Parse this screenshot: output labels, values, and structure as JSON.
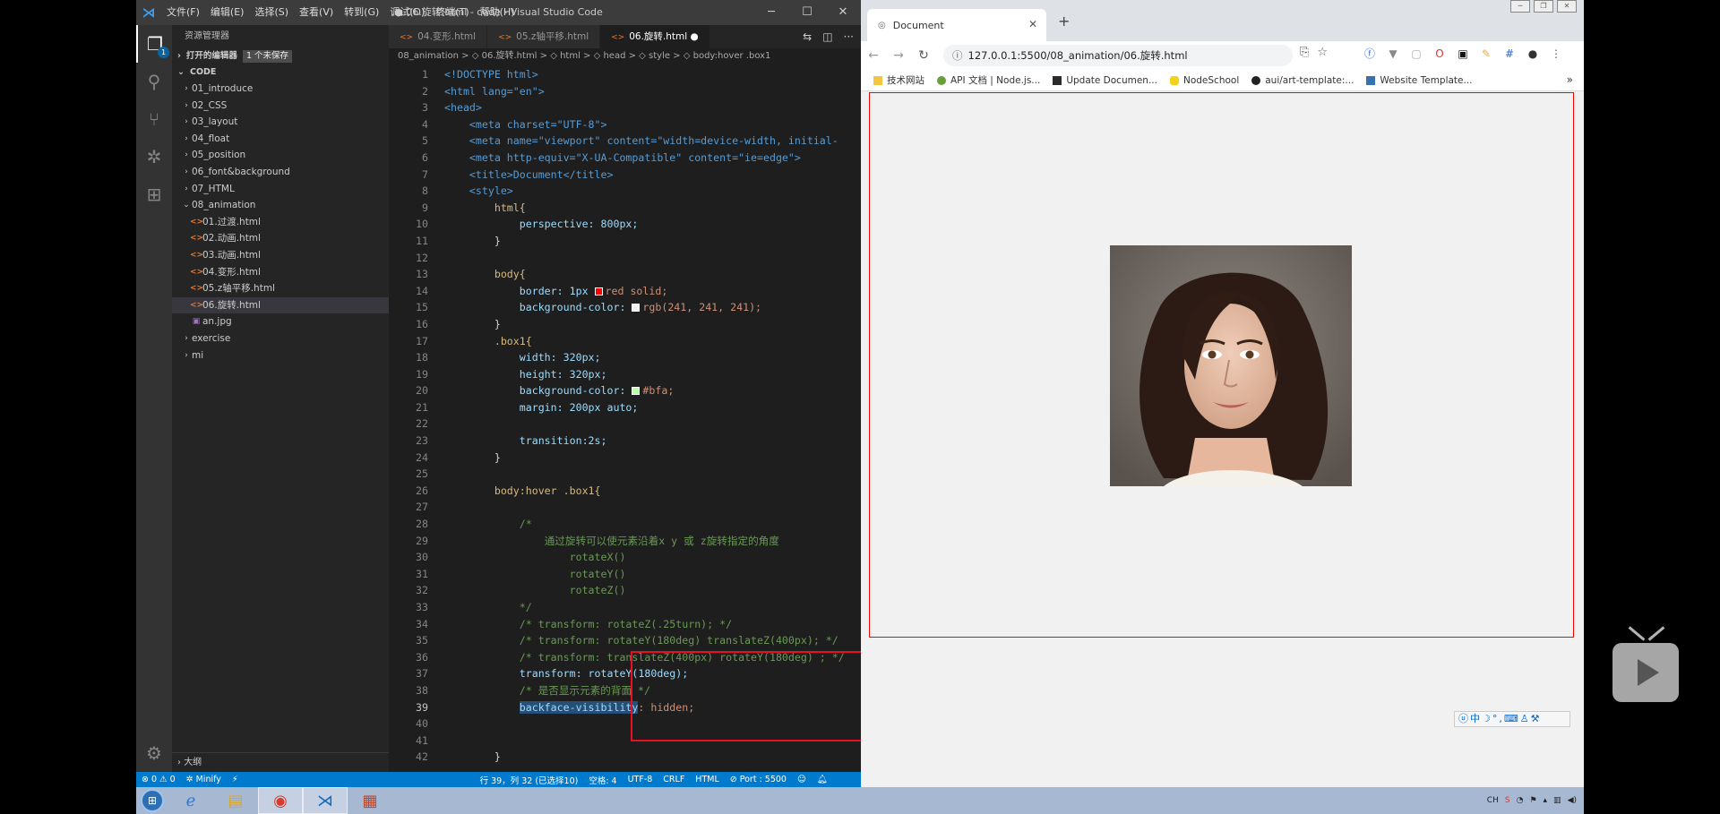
{
  "vscode": {
    "menu": [
      "文件(F)",
      "编辑(E)",
      "选择(S)",
      "查看(V)",
      "转到(G)",
      "调试(D)",
      "终端(T)",
      "帮助(H)"
    ],
    "window_title": "● 06.旋转.html - code - Visual Studio Code",
    "activity_badge": "1",
    "sidebar": {
      "header": "资源管理器",
      "open_editors": "打开的编辑器",
      "unsaved": "1 个未保存",
      "root": "CODE",
      "tree": [
        {
          "label": "01_introduce"
        },
        {
          "label": "02_CSS"
        },
        {
          "label": "03_layout"
        },
        {
          "label": "04_float"
        },
        {
          "label": "05_position"
        },
        {
          "label": "06_font&background"
        },
        {
          "label": "07_HTML"
        },
        {
          "label": "08_animation"
        },
        {
          "label": "01.过渡.html"
        },
        {
          "label": "02.动画.html"
        },
        {
          "label": "03.动画.html"
        },
        {
          "label": "04.变形.html"
        },
        {
          "label": "05.z轴平移.html"
        },
        {
          "label": "06.旋转.html"
        },
        {
          "label": "an.jpg"
        },
        {
          "label": "exercise"
        },
        {
          "label": "mi"
        }
      ],
      "outline": "大纲"
    },
    "tabs": [
      "04.变形.html",
      "05.z轴平移.html",
      "06.旋转.html"
    ],
    "breadcrumb": "08_animation > ◇ 06.旋转.html > ◇ html > ◇ head > ◇ style > ◇ body:hover .box1",
    "code_lines": [
      "1",
      "2",
      "3",
      "4",
      "5",
      "6",
      "7",
      "8",
      "9",
      "10",
      "11",
      "12",
      "13",
      "14",
      "15",
      "16",
      "17",
      "18",
      "19",
      "20",
      "21",
      "22",
      "23",
      "24",
      "25",
      "26",
      "27",
      "28",
      "29",
      "30",
      "31",
      "32",
      "33",
      "34",
      "35",
      "36",
      "37",
      "38",
      "39",
      "40",
      "41",
      "42"
    ],
    "code": {
      "doctype": "<!DOCTYPE html>",
      "html_open": "<html lang=\"en\">",
      "head_open": "<head>",
      "meta_charset": "<meta charset=\"UTF-8\">",
      "meta_viewport": "<meta name=\"viewport\" content=\"width=device-width, initial-",
      "meta_compat": "<meta http-equiv=\"X-UA-Compatible\" content=\"ie=edge\">",
      "title": "<title>Document</title>",
      "style_open": "<style>",
      "l9": "html{",
      "l10": "perspective: 800px;",
      "l11": "}",
      "l13": "body{",
      "l14a": "border: 1px ",
      "l14b": "red solid;",
      "l15a": "background-color: ",
      "l15b": "rgb(241, 241, 241);",
      "l16": "}",
      "l17": ".box1{",
      "l18": "width: 320px;",
      "l19": "height: 320px;",
      "l20a": "background-color: ",
      "l20b": "#bfa;",
      "l21": "margin: 200px auto;",
      "l23": "transition:2s;",
      "l24": "}",
      "l26": "body:hover .box1{",
      "l28": "/*",
      "l29": "通过旋转可以使元素沿着x y 或 z旋转指定的角度",
      "l30": "rotateX()",
      "l31": "rotateY()",
      "l32": "rotateZ()",
      "l33": "*/",
      "l34": "/* transform: rotateZ(.25turn); */",
      "l35": "/* transform: rotateY(180deg) translateZ(400px); */",
      "l36": "/* transform: translateZ(400px) rotateY(180deg) ; */",
      "l37": "transform: rotateY(180deg);",
      "l38": "/* 是否显示元素的背面 */",
      "l39a": "backface-visibility",
      "l39b": ": hidden;",
      "l42": "}"
    },
    "status": {
      "problems": "⊗ 0 ⚠ 0",
      "minify": "✲ Minify",
      "bolt": "⚡",
      "position": "行 39，列 32 (已选择10)",
      "spaces": "空格: 4",
      "encoding": "UTF-8",
      "eol": "CRLF",
      "language": "HTML",
      "port": "⊘ Port : 5500"
    },
    "swatches": {
      "red": "#ff0000",
      "rgb": "#f1f1f1",
      "bfa": "#bbffaa"
    }
  },
  "browser": {
    "tab_title": "Document",
    "url": "127.0.0.1:5500/08_animation/06.旋转.html",
    "bookmarks": [
      {
        "label": "技术网站",
        "color": "#f4c542"
      },
      {
        "label": "API 文档 | Node.js...",
        "color": "#6a9f3c"
      },
      {
        "label": "Update Documen...",
        "color": "#2b2b2b"
      },
      {
        "label": "NodeSchool",
        "color": "#f2d21a"
      },
      {
        "label": "aui/art-template:...",
        "color": "#222222"
      },
      {
        "label": "Website Template...",
        "color": "#3a6fb0"
      }
    ],
    "page_border_color": "#ff0000",
    "page_bg": "#f1f1f1"
  },
  "ime_bar": "ⓤ中☽°,⌨♙⚒"
}
